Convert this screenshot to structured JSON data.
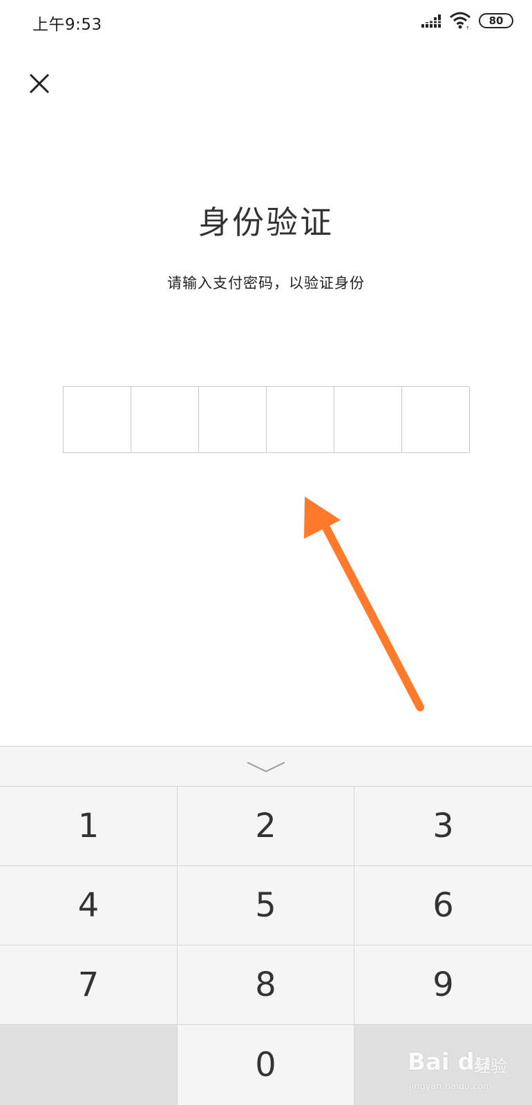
{
  "status_bar": {
    "time": "上午9:53",
    "battery_level": "80",
    "icons": [
      "signal-icon",
      "wifi-icon",
      "battery-icon"
    ]
  },
  "header": {
    "close_icon": "close-icon"
  },
  "main": {
    "title": "身份验证",
    "subtitle": "请输入支付密码，以验证身份",
    "pin_length": 6
  },
  "annotation": {
    "arrow_color": "#FF7A2B"
  },
  "keyboard": {
    "collapse_icon": "chevron-down-icon",
    "keys": [
      {
        "label": "1"
      },
      {
        "label": "2"
      },
      {
        "label": "3"
      },
      {
        "label": "4"
      },
      {
        "label": "5"
      },
      {
        "label": "6"
      },
      {
        "label": "7"
      },
      {
        "label": "8"
      },
      {
        "label": "9"
      },
      {
        "label": ""
      },
      {
        "label": "0"
      },
      {
        "label": ""
      }
    ]
  },
  "watermark": {
    "brand": "Bai du",
    "suffix": "经验",
    "url": "jingyan.baidu.com"
  },
  "colors": {
    "background": "#FFFFFF",
    "keyboard_bg": "#F5F5F5",
    "blank_key_bg": "#E0E0E0",
    "border": "#C9C9C9",
    "text": "#333333"
  }
}
